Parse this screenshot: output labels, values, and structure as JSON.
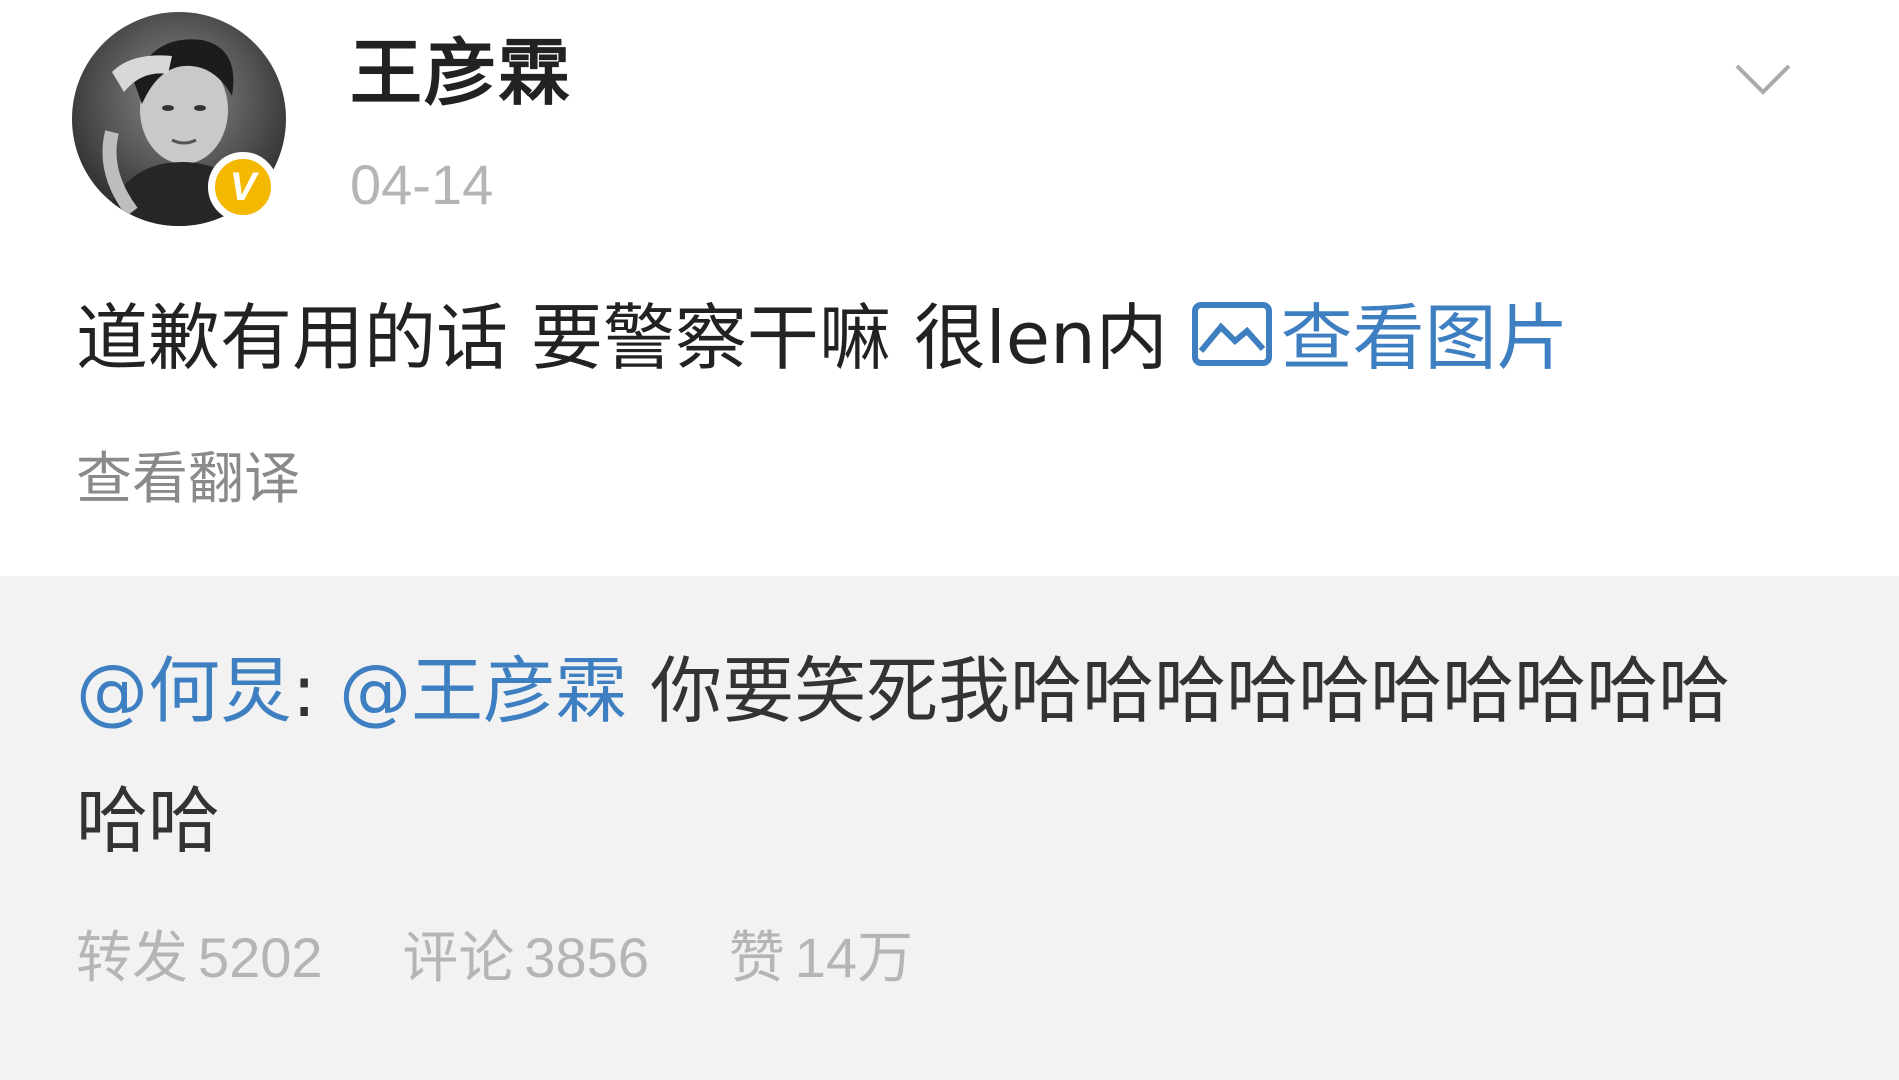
{
  "post": {
    "author": {
      "name": "王彦霖",
      "verified_badge": "V",
      "badge_color": "#f5b800"
    },
    "timestamp": "04-14",
    "menu_icon": "chevron-down-icon",
    "text": "道歉有用的话 要警察干嘛 很len内",
    "view_image_label": "查看图片",
    "view_image_icon": "image-icon",
    "translate_label": "查看翻译",
    "link_color": "#3d7fc1"
  },
  "repost": {
    "mention_author": "@何炅",
    "separator": ":",
    "mention_target": "@王彦霖",
    "text": "你要笑死我哈哈哈哈哈哈哈哈哈哈哈哈",
    "background": "#f2f2f2"
  },
  "stats": {
    "repost_label": "转发",
    "repost_count": "5202",
    "comment_label": "评论",
    "comment_count": "3856",
    "like_label": "赞",
    "like_count": "14万"
  }
}
